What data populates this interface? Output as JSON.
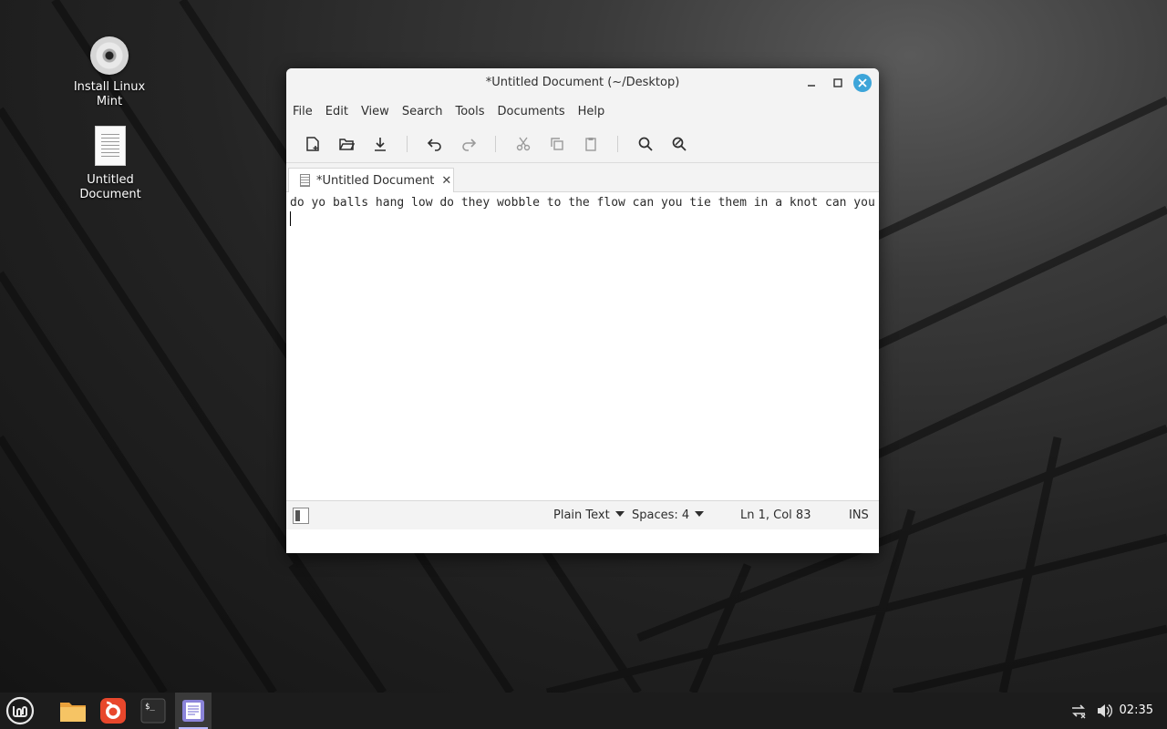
{
  "desktop": {
    "icons": [
      {
        "label": "Install Linux Mint",
        "icon": "disc-icon"
      },
      {
        "label": "Untitled Document",
        "icon": "text-file-icon"
      }
    ]
  },
  "window": {
    "title": "*Untitled Document (~/Desktop)",
    "menu": [
      "File",
      "Edit",
      "View",
      "Search",
      "Tools",
      "Documents",
      "Help"
    ],
    "toolbar_icons": [
      "new-document-icon",
      "open-folder-icon",
      "save-download-icon",
      "undo-icon",
      "redo-icon",
      "cut-icon",
      "copy-icon",
      "paste-icon",
      "search-icon",
      "replace-icon"
    ],
    "tab": {
      "label": "*Untitled Document",
      "close": "✕"
    },
    "editor": {
      "text": "do yo balls hang low do they wobble to the flow can you tie them in a knot can you"
    },
    "status": {
      "language": "Plain Text",
      "spaces": "Spaces: 4",
      "position": "Ln 1, Col 83",
      "mode": "INS"
    }
  },
  "taskbar": {
    "items": [
      "menu-icon",
      "files-icon",
      "firefox-icon",
      "terminal-icon",
      "text-editor-icon"
    ],
    "clock": "02:35",
    "tray": [
      "network-icon",
      "volume-icon"
    ]
  },
  "colors": {
    "accent": "#3da5d9",
    "taskbar": "#1c1c1c"
  }
}
